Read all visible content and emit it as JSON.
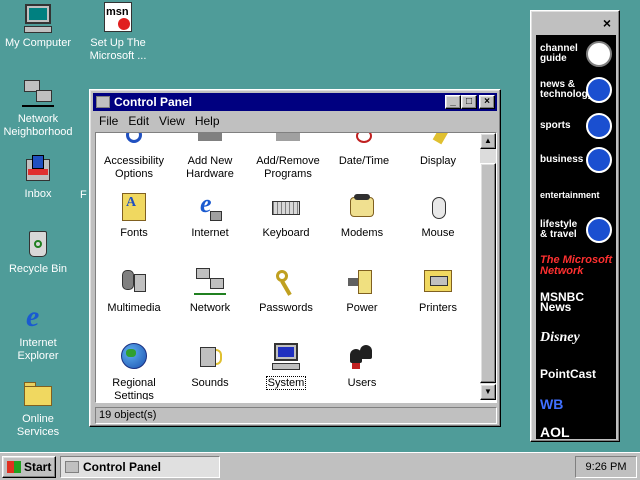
{
  "desktop": {
    "icons": [
      {
        "label": "My Computer",
        "icon": "computer-icon"
      },
      {
        "label": "Set Up The Microsoft ...",
        "icon": "msn-icon"
      },
      {
        "label": "Network Neighborhood",
        "icon": "network-icon"
      },
      {
        "label": "Inbox",
        "icon": "inbox-icon"
      },
      {
        "label": "F",
        "icon": "partial-folder-icon"
      },
      {
        "label": "Recycle Bin",
        "icon": "recycle-bin-icon"
      },
      {
        "label": "Internet Explorer",
        "icon": "ie-icon"
      },
      {
        "label": "Online Services",
        "icon": "folder-icon"
      }
    ]
  },
  "window": {
    "title": "Control Panel",
    "menu": [
      "File",
      "Edit",
      "View",
      "Help"
    ],
    "items": [
      {
        "label": "Accessibility Options",
        "icon": "accessibility-icon"
      },
      {
        "label": "Add New Hardware",
        "icon": "hardware-icon"
      },
      {
        "label": "Add/Remove Programs",
        "icon": "add-remove-icon"
      },
      {
        "label": "Date/Time",
        "icon": "clock-icon"
      },
      {
        "label": "Display",
        "icon": "display-icon"
      },
      {
        "label": "Fonts",
        "icon": "fonts-icon"
      },
      {
        "label": "Internet",
        "icon": "internet-icon"
      },
      {
        "label": "Keyboard",
        "icon": "keyboard-icon"
      },
      {
        "label": "Modems",
        "icon": "modem-icon"
      },
      {
        "label": "Mouse",
        "icon": "mouse-icon"
      },
      {
        "label": "Multimedia",
        "icon": "multimedia-icon"
      },
      {
        "label": "Network",
        "icon": "network-icon"
      },
      {
        "label": "Passwords",
        "icon": "keys-icon"
      },
      {
        "label": "Power",
        "icon": "power-icon"
      },
      {
        "label": "Printers",
        "icon": "printer-icon"
      },
      {
        "label": "Regional Settings",
        "icon": "globe-icon"
      },
      {
        "label": "Sounds",
        "icon": "speaker-icon"
      },
      {
        "label": "System",
        "icon": "system-icon"
      },
      {
        "label": "Users",
        "icon": "users-icon"
      }
    ],
    "status": "19 object(s)"
  },
  "channel_bar": {
    "close": "×",
    "channels": [
      {
        "label": "channel guide"
      },
      {
        "label": "news & technology"
      },
      {
        "label": "sports"
      },
      {
        "label": "business"
      },
      {
        "label": "entertainment"
      },
      {
        "label": "lifestyle & travel"
      },
      {
        "label": "The Microsoft Network"
      },
      {
        "label": "MSNBC News"
      },
      {
        "label": "Disney"
      },
      {
        "label": "PointCast"
      },
      {
        "label": "WB"
      },
      {
        "label": "AOL"
      }
    ]
  },
  "taskbar": {
    "start": "Start",
    "task": "Control Panel",
    "clock": "9:26 PM"
  },
  "colors": {
    "desktop": "#4f9c99",
    "title_active": "#000080",
    "face": "#c0c0c0"
  }
}
